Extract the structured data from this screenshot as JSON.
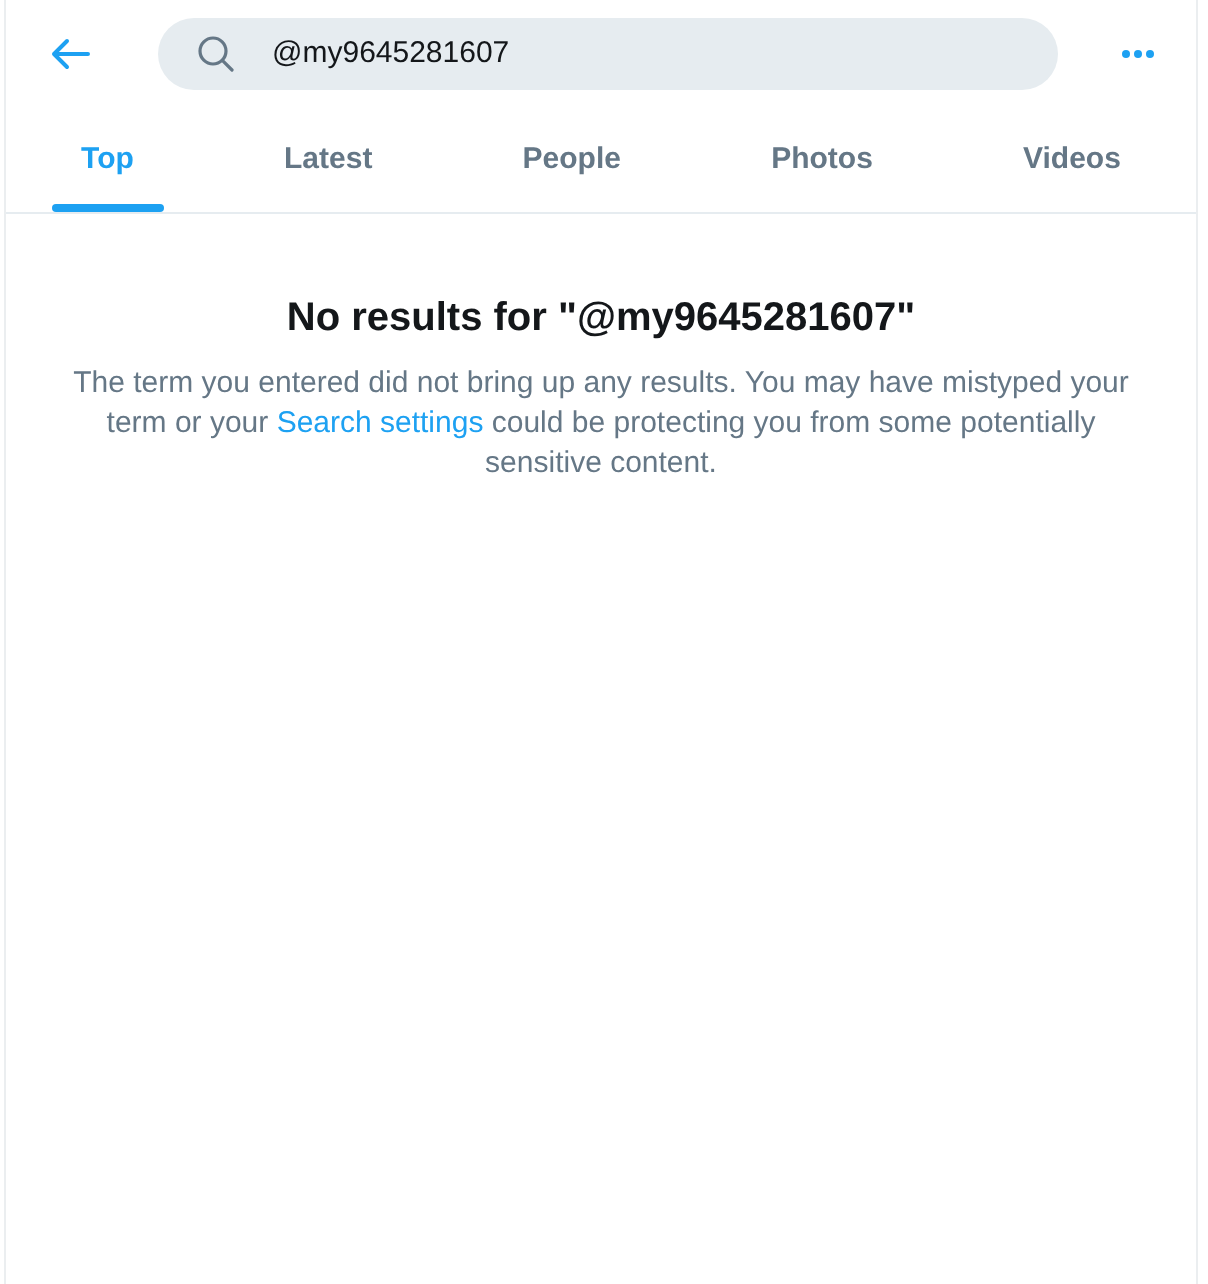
{
  "header": {
    "search": {
      "value": "@my9645281607"
    }
  },
  "tabs": [
    {
      "label": "Top",
      "selected": true
    },
    {
      "label": "Latest",
      "selected": false
    },
    {
      "label": "People",
      "selected": false
    },
    {
      "label": "Photos",
      "selected": false
    },
    {
      "label": "Videos",
      "selected": false
    }
  ],
  "empty_state": {
    "title": "No results for \"@my9645281607\"",
    "message_before": "The term you entered did not bring up any results. You may have mistyped your term or your ",
    "link": "Search settings",
    "message_after": " could be protecting you from some potentially sensitive content."
  }
}
